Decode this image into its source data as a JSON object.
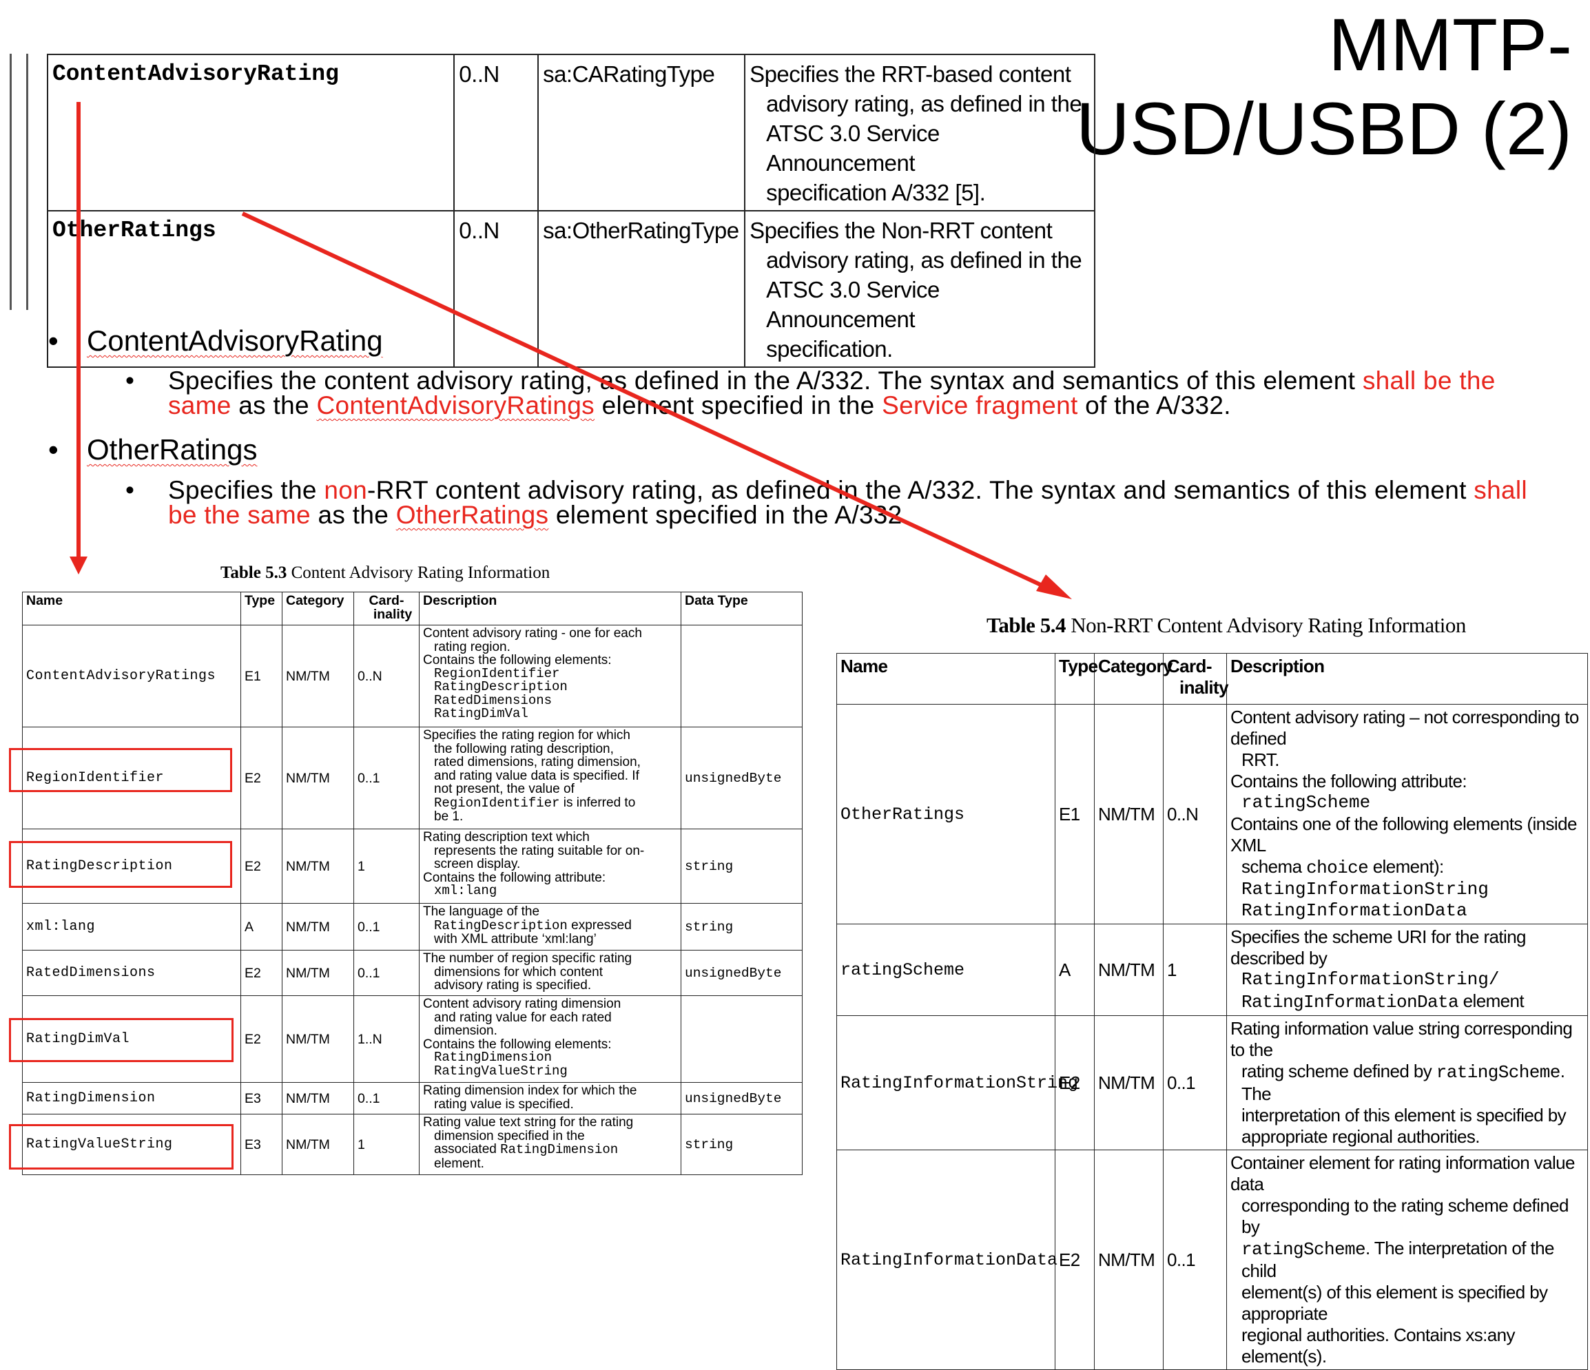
{
  "title_lines": [
    "MMTP-",
    "USD/USBD (2)"
  ],
  "spec_rows": [
    {
      "name": "ContentAdvisoryRating",
      "card": "0..N",
      "type": "sa:CARatingType",
      "desc_first": "Specifies the RRT-based content",
      "desc_rest": [
        "advisory rating, as defined in the",
        "ATSC 3.0 Service Announcement",
        "specification A/332 [5]."
      ]
    },
    {
      "name": "OtherRatings",
      "card": "0..N",
      "type": "sa:OtherRatingType",
      "desc_first": "Specifies the Non-RRT content",
      "desc_rest": [
        "advisory rating, as defined in the",
        "ATSC 3.0 Service Announcement",
        "specification."
      ]
    }
  ],
  "bullets": {
    "car": {
      "heading": "ContentAdvisoryRating",
      "text_1": "Specifies the content advisory rating, as defined in the A/332. The syntax and semantics of this element ",
      "red_1": "shall be the same",
      "text_2": " as the ",
      "red_2": "ContentAdvisoryRatings",
      "text_3": " element specified in the ",
      "red_3": "Service fragment",
      "text_4": " of the A/332."
    },
    "or": {
      "heading": "OtherRatings",
      "text_1": "Specifies the ",
      "red_1": "non",
      "text_2": "-RRT content advisory rating, as defined in the A/332. The syntax and semantics of this element ",
      "red_2": "shall be the same",
      "text_3": " as the ",
      "red_3": "OtherRatings",
      "text_4": " element specified in the A/332."
    }
  },
  "table53": {
    "caption_bold": "Table 5.3",
    "caption_rest": " Content Advisory Rating Information",
    "headers": {
      "name": "Name",
      "type": "Type",
      "category": "Category",
      "card": "Card-inality",
      "desc": "Description",
      "dtype": "Data Type"
    },
    "rows": [
      {
        "name": "ContentAdvisoryRatings",
        "type": "E1",
        "cat": "NM/TM",
        "card": "0..N",
        "dtype": "",
        "desc": [
          "Content advisory rating - one for each",
          "rating region.",
          "Contains the following elements:"
        ],
        "codes": [
          "RegionIdentifier",
          "RatingDescription",
          "RatedDimensions",
          "RatingDimVal"
        ]
      },
      {
        "name": "RegionIdentifier",
        "type": "E2",
        "cat": "NM/TM",
        "card": "0..1",
        "dtype": "unsignedByte",
        "desc": [
          "Specifies the rating region for which",
          "the following rating description,",
          "rated dimensions, rating dimension,",
          "and rating value data is specified. If",
          "not present, the value of"
        ],
        "code_inline": "RegionIdentifier",
        "desc_after": " is inferred to",
        "desc_tail": "be 1."
      },
      {
        "name": "RatingDescription",
        "type": "E2",
        "cat": "NM/TM",
        "card": "1",
        "dtype": "string",
        "desc": [
          "Rating description text which",
          "represents the rating suitable for on-",
          "screen display.",
          "Contains the following attribute:"
        ],
        "codes": [
          "xml:lang"
        ]
      },
      {
        "name": "xml:lang",
        "type": "A",
        "cat": "NM/TM",
        "card": "0..1",
        "dtype": "string",
        "desc": [
          "The language of the"
        ],
        "code_inline": "RatingDescription",
        "desc_after": " expressed",
        "desc_tail": "with XML attribute ‘xml:lang’"
      },
      {
        "name": "RatedDimensions",
        "type": "E2",
        "cat": "NM/TM",
        "card": "0..1",
        "dtype": "unsignedByte",
        "desc": [
          "The number of region specific rating",
          "dimensions for which content",
          "advisory rating is specified."
        ]
      },
      {
        "name": "RatingDimVal",
        "type": "E2",
        "cat": "NM/TM",
        "card": "1..N",
        "dtype": "",
        "desc": [
          "Content advisory rating dimension",
          "and rating value for each rated",
          "dimension.",
          "Contains the following elements:"
        ],
        "codes": [
          "RatingDimension",
          "RatingValueString"
        ]
      },
      {
        "name": "RatingDimension",
        "type": "E3",
        "cat": "NM/TM",
        "card": "0..1",
        "dtype": "unsignedByte",
        "desc": [
          "Rating dimension index for which the",
          "rating value is specified."
        ]
      },
      {
        "name": "RatingValueString",
        "type": "E3",
        "cat": "NM/TM",
        "card": "1",
        "dtype": "string",
        "desc": [
          "Rating value text string for the rating",
          "dimension specified in the",
          "associated"
        ],
        "code_inline": "RatingDimension",
        "desc_tail": "element."
      }
    ]
  },
  "table54": {
    "caption_bold": "Table 5.4",
    "caption_rest": " Non-RRT Content Advisory Rating Information",
    "headers": {
      "name": "Name",
      "type": "Type",
      "category": "Category",
      "card": "Card-inality",
      "desc": "Description"
    },
    "rows": [
      {
        "name": "OtherRatings",
        "type": "E1",
        "cat": "NM/TM",
        "card": "0..N",
        "d1": "Content advisory rating – not corresponding to defined",
        "d1b": "RRT.",
        "d2": "Contains the following attribute:",
        "c1": "ratingScheme",
        "d3": "Contains one of the following elements (inside XML",
        "d3b_pre": "schema ",
        "d3b_code": "choice",
        "d3b_post": " element):",
        "c2": "RatingInformationString",
        "c3": "RatingInformationData"
      },
      {
        "name": "ratingScheme",
        "type": "A",
        "cat": "NM/TM",
        "card": "1",
        "d1": "Specifies the scheme URI for the rating described by",
        "c1": "RatingInformationString/",
        "c2": "RatingInformationData",
        "c2_post": "  element"
      },
      {
        "name": "RatingInformationString",
        "type": "E2",
        "cat": "NM/TM",
        "card": "0..1",
        "d1": "Rating information value string corresponding to the",
        "d2_pre": "rating scheme defined by ",
        "d2_code": "ratingScheme",
        "d2_post": ". The",
        "d3": "interpretation of this element is specified by",
        "d4": "appropriate regional authorities."
      },
      {
        "name": "RatingInformationData",
        "type": "E2",
        "cat": "NM/TM",
        "card": "0..1",
        "d1": "Container element for rating information value data",
        "d2": "corresponding to the rating scheme defined by",
        "d3_code": "ratingScheme",
        "d3_post": ". The interpretation of the child",
        "d4": "element(s) of this element is specified by appropriate",
        "d5": "regional authorities. Contains xs:any element(s)."
      }
    ]
  },
  "accent_color": "#e8261e"
}
